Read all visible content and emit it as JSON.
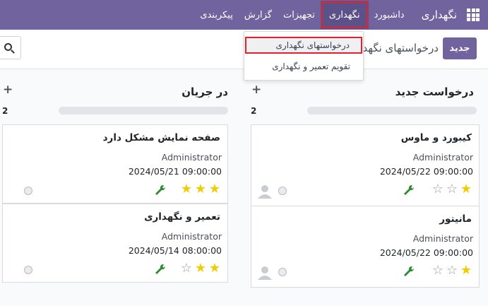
{
  "navbar": {
    "brand": "نگهداری",
    "items": [
      "داشبورد",
      "نگهداری",
      "تجهیزات",
      "گزارش",
      "پیکربندی"
    ],
    "active_item": "نگهداری"
  },
  "control": {
    "new_button": "جدید",
    "breadcrumb": "درخواستهای نگهداری"
  },
  "dropdown": {
    "items": [
      "درخواستهای نگهداری",
      "تقویم تعمیر و نگهداری"
    ]
  },
  "columns": [
    {
      "title": "درخواست جدید",
      "count": "2",
      "add": "+",
      "cards": [
        {
          "title": "کیبورد و ماوس",
          "user": "Administrator",
          "date": "2024/05/22 09:00:00",
          "stars_on": 1
        },
        {
          "title": "مانیتور",
          "user": "Administrator",
          "date": "2024/05/22 09:00:00",
          "stars_on": 1
        }
      ]
    },
    {
      "title": "در جریان",
      "count": "2",
      "add": "+",
      "cards": [
        {
          "title": "صفحه نمایش مشکل دارد",
          "user": "Administrator",
          "date": "2024/05/21 09:00:00",
          "stars_on": 3
        },
        {
          "title": "تعمیر و نگهداری",
          "user": "Administrator",
          "date": "2024/05/14 08:00:00",
          "stars_on": 2
        }
      ]
    }
  ],
  "colors": {
    "navbar": "#71639e",
    "highlight": "#e5222b",
    "star": "#f3cc00",
    "wrench": "#2e8b2e"
  },
  "icons": [
    "apps-grid-icon",
    "search-icon",
    "plus-icon",
    "star-icon",
    "wrench-icon",
    "status-circle-icon",
    "user-avatar-icon"
  ]
}
